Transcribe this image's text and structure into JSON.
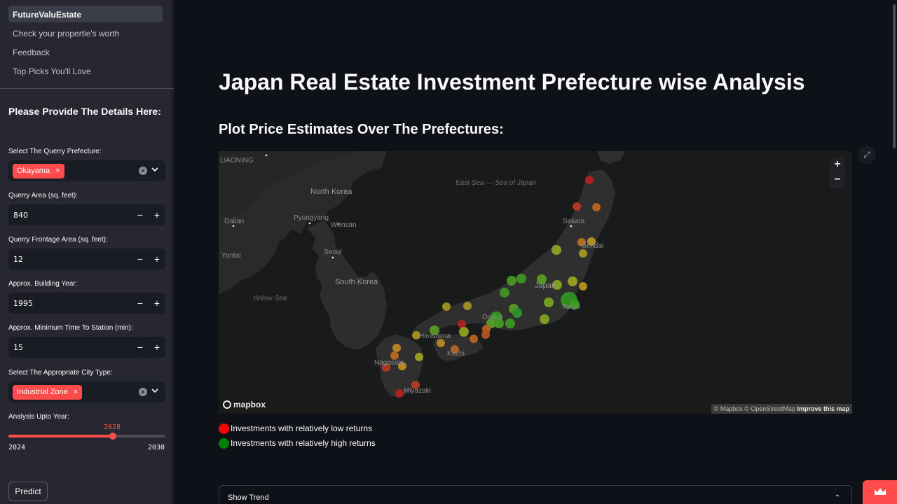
{
  "sidebar": {
    "nav": [
      {
        "label": "FutureValuEstate",
        "active": true
      },
      {
        "label": "Check your propertie's worth",
        "active": false
      },
      {
        "label": "Feedback",
        "active": false
      },
      {
        "label": "Top Picks You'll Love",
        "active": false
      }
    ],
    "heading": "Please Provide The Details Here:",
    "prefecture_label": "Select The Querry Prefecture:",
    "prefecture_tag": "Okayama",
    "area_label": "Querry Area (sq. feet):",
    "area_value": "840",
    "frontage_label": "Querry Frontage Area (sq. feet):",
    "frontage_value": "12",
    "building_year_label": "Approx. Building Year:",
    "building_year_value": "1995",
    "station_label": "Approx. Minimum Time To Station (min):",
    "station_value": "15",
    "city_type_label": "Select The Appropriate City Type:",
    "city_type_tag": "Industrial Zone",
    "analysis_label": "Analysis Upto Year:",
    "slider": {
      "value": "2028",
      "min": "2024",
      "max": "2030",
      "fraction": 0.667
    },
    "predict_label": "Predict",
    "minus": "−",
    "plus": "+"
  },
  "main": {
    "title": "Japan Real Estate Investment Prefecture wise Analysis",
    "subtitle": "Plot Price Estimates Over The Prefectures:",
    "legend": [
      {
        "color": "#ff0000",
        "label": "Investments with relatively low returns"
      },
      {
        "color": "#008000",
        "label": "Investments with relatively high returns"
      }
    ],
    "expander_label": "Show Trend"
  },
  "map": {
    "labels": {
      "liaoning": "LIAONING",
      "north_korea": "North Korea",
      "pyongyang": "Pyongyang",
      "wonsan": "Wonsan",
      "dalian": "Dalian",
      "yantai": "Yantai",
      "seoul": "Seoul",
      "south_korea": "South Korea",
      "yellow_sea": "Yellow Sea",
      "east_sea": "East Sea — Sea of Japan",
      "japan": "Japan",
      "sakata": "Sakata",
      "sendai": "Sendai",
      "tokyo": "Tokyo",
      "osaka": "Osaka",
      "hiroshima": "Hiroshima",
      "kochi": "Kochi",
      "nagasaki": "Nagasaki",
      "miyazaki": "Miyazaki"
    },
    "zoom_in": "+",
    "zoom_out": "−",
    "logo": "mapbox",
    "attribution_1": "© Mapbox © OpenStreetMap",
    "attribution_2": "Improve this map"
  }
}
